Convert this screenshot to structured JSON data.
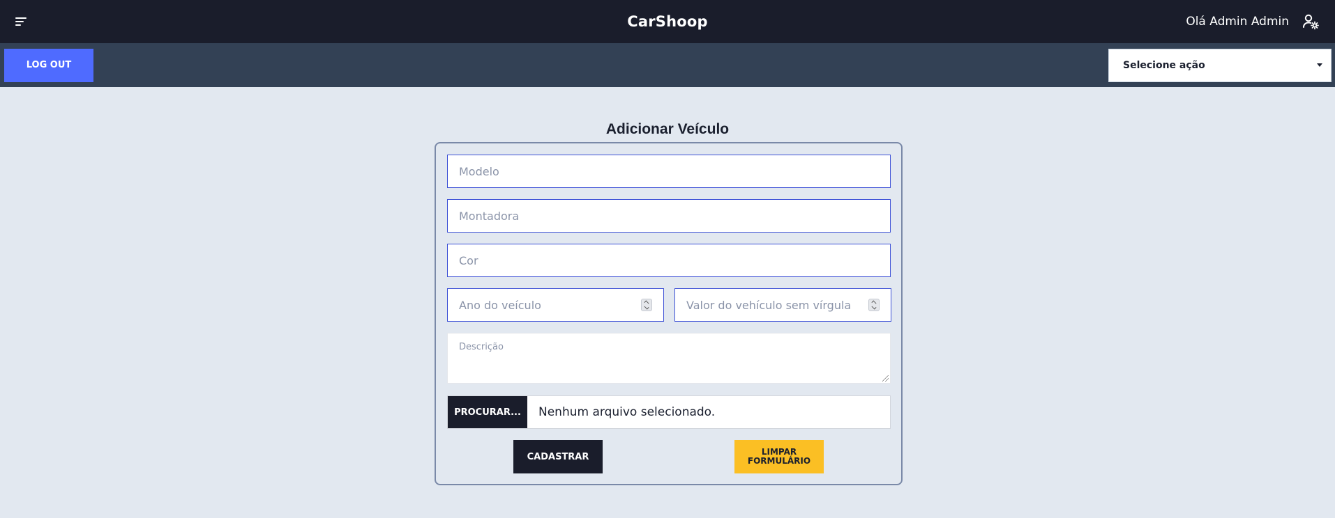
{
  "header": {
    "brand": "CarShoop",
    "greeting": "Olá Admin Admin"
  },
  "subbar": {
    "logout_label": "LOG OUT",
    "action_select_value": "Selecione ação"
  },
  "form": {
    "title": "Adicionar Veículo",
    "model_placeholder": "Modelo",
    "maker_placeholder": "Montadora",
    "color_placeholder": "Cor",
    "year_placeholder": "Ano do veículo",
    "price_placeholder": "Valor do vehículo sem vírgula",
    "description_placeholder": "Descrição",
    "file_button_label": "PROCURAR...",
    "file_status": "Nenhum arquivo selecionado.",
    "submit_label": "CADASTRAR",
    "clear_label": "LIMPAR FORMULÁRIO"
  },
  "icons": {
    "menu": "menu-icon",
    "user_settings": "user-cog-icon",
    "dropdown": "chevron-down-icon"
  },
  "colors": {
    "topbar": "#1a1d2b",
    "subbar": "#334155",
    "logout": "#4f6bff",
    "clear": "#fbbf24",
    "background": "#e2e8f0"
  }
}
